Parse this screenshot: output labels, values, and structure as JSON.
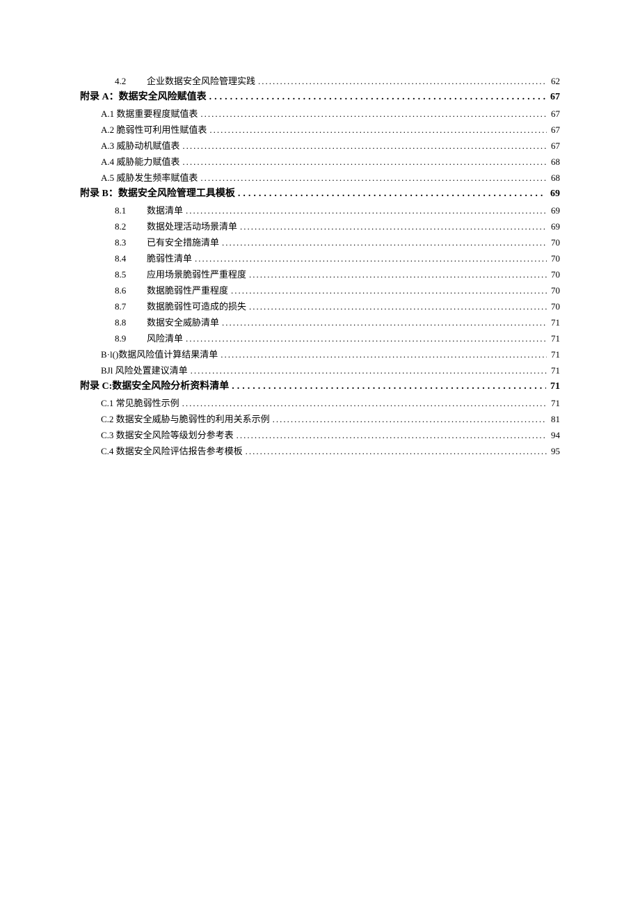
{
  "entries": [
    {
      "level": "level2-num",
      "num": "4.2",
      "label": "企业数据安全风险管理实践",
      "page": "62"
    },
    {
      "level": "level1",
      "num": "",
      "label": "附录 A：数据安全风险赋值表",
      "page": "67"
    },
    {
      "level": "level2",
      "num": "",
      "label": "A.1 数据重要程度赋值表",
      "page": "67"
    },
    {
      "level": "level2",
      "num": "",
      "label": "A.2 脆弱性可利用性赋值表",
      "page": "67"
    },
    {
      "level": "level2",
      "num": "",
      "label": "A.3 威胁动机赋值表",
      "page": "67"
    },
    {
      "level": "level2",
      "num": "",
      "label": "A.4 威胁能力赋值表",
      "page": "68"
    },
    {
      "level": "level2",
      "num": "",
      "label": "A.5 威胁发生频率赋值表",
      "page": "68"
    },
    {
      "level": "level1",
      "num": "",
      "label": "附录 B：数据安全风险管理工具模板",
      "page": "69"
    },
    {
      "level": "level2-num",
      "num": "8.1",
      "label": "数据清单",
      "page": "69"
    },
    {
      "level": "level2-num",
      "num": "8.2",
      "label": "数据处理活动场景清单",
      "page": "69"
    },
    {
      "level": "level2-num",
      "num": "8.3",
      "label": "已有安全措施清单",
      "page": "70"
    },
    {
      "level": "level2-num",
      "num": "8.4",
      "label": "脆弱性清单",
      "page": "70"
    },
    {
      "level": "level2-num",
      "num": "8.5",
      "label": "应用场景脆弱性严重程度",
      "page": "70"
    },
    {
      "level": "level2-num",
      "num": "8.6",
      "label": "数据脆弱性严重程度",
      "page": "70"
    },
    {
      "level": "level2-num",
      "num": "8.7",
      "label": "数据脆弱性可造成的损失",
      "page": "70"
    },
    {
      "level": "level2-num",
      "num": "8.8",
      "label": "数据安全威胁清单",
      "page": "71"
    },
    {
      "level": "level2-num",
      "num": "8.9",
      "label": "风险清单",
      "page": "71"
    },
    {
      "level": "level2",
      "num": "",
      "label": "B·l()数据风险值计算结果清单",
      "page": "71"
    },
    {
      "level": "level2",
      "num": "",
      "label": "BJl 风险处置建议清单",
      "page": "71"
    },
    {
      "level": "level1",
      "num": "",
      "label": "附录 C:数据安全风险分析资料清单",
      "page": "71"
    },
    {
      "level": "level2",
      "num": "",
      "label": "C.1 常见脆弱性示例",
      "page": "71"
    },
    {
      "level": "level2",
      "num": "",
      "label": "C.2 数据安全威胁与脆弱性的利用关系示例",
      "page": "81"
    },
    {
      "level": "level2",
      "num": "",
      "label": "C.3 数据安全风险等级划分参考表",
      "page": "94"
    },
    {
      "level": "level2",
      "num": "",
      "label": "C.4 数据安全风险评估报告参考模板",
      "page": "95"
    }
  ]
}
